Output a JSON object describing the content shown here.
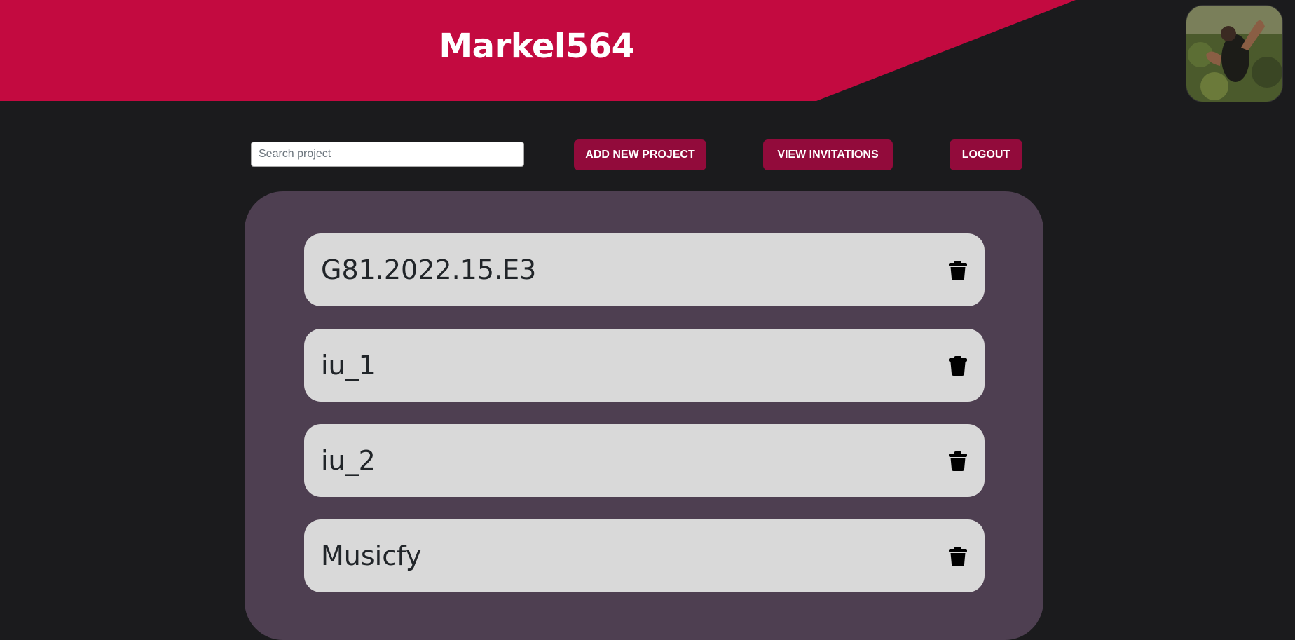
{
  "header": {
    "username": "Markel564",
    "accent_color": "#c30a40",
    "avatar_alt": "user-avatar"
  },
  "toolbar": {
    "search_placeholder": "Search project",
    "search_value": "",
    "add_label": "ADD NEW PROJECT",
    "invitations_label": "VIEW INVITATIONS",
    "logout_label": "LOGOUT",
    "button_color": "#920b3b"
  },
  "projects": {
    "items": [
      {
        "name": "G81.2022.15.E3",
        "action_icon": "trash-icon"
      },
      {
        "name": "iu_1",
        "action_icon": "trash-icon"
      },
      {
        "name": "iu_2",
        "action_icon": "trash-icon"
      },
      {
        "name": "Musicfy",
        "action_icon": "trash-icon"
      }
    ]
  }
}
